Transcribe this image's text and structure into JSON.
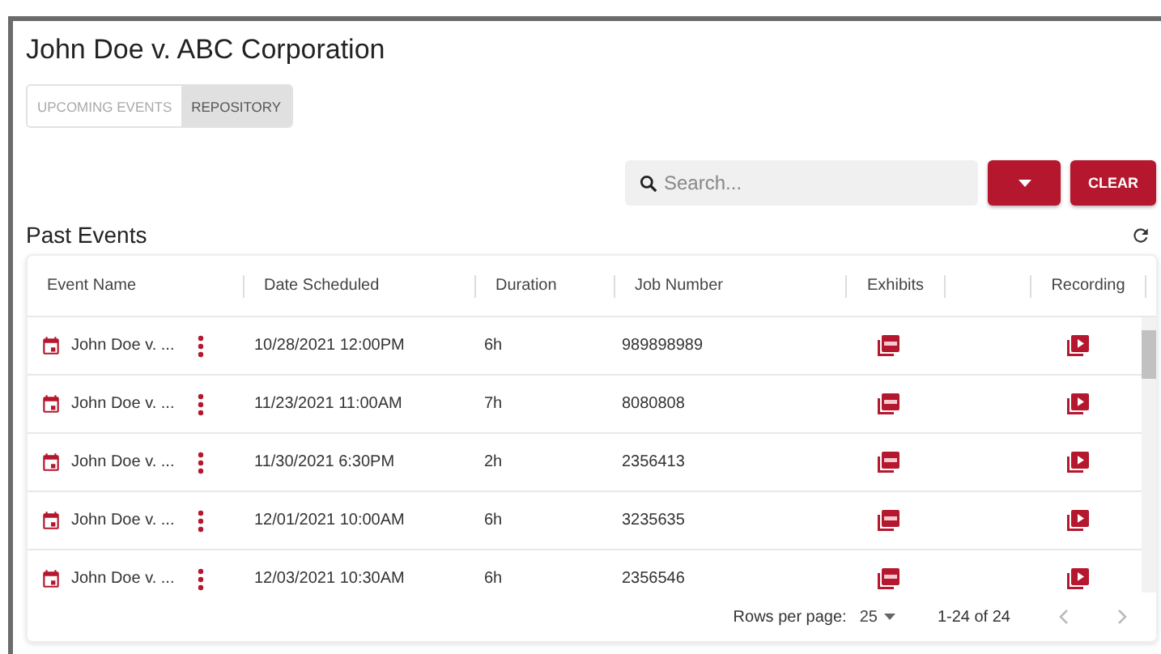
{
  "title": "John Doe v. ABC Corporation",
  "tabs": [
    {
      "label": "UPCOMING EVENTS",
      "selected": false
    },
    {
      "label": "REPOSITORY",
      "selected": true
    }
  ],
  "search": {
    "placeholder": "Search..."
  },
  "clear_button": "CLEAR",
  "section_title": "Past Events",
  "table": {
    "columns": [
      "Event Name",
      "Date Scheduled",
      "Duration",
      "Job Number",
      "Exhibits",
      "",
      "Recording"
    ],
    "rows": [
      {
        "event_name": "John Doe v. ...",
        "date": "10/28/2021 12:00PM",
        "duration": "6h",
        "job_number": "989898989"
      },
      {
        "event_name": "John Doe v. ...",
        "date": "11/23/2021 11:00AM",
        "duration": "7h",
        "job_number": "8080808"
      },
      {
        "event_name": "John Doe v. ...",
        "date": "11/30/2021 6:30PM",
        "duration": "2h",
        "job_number": "2356413"
      },
      {
        "event_name": "John Doe v. ...",
        "date": "12/01/2021 10:00AM",
        "duration": "6h",
        "job_number": "3235635"
      },
      {
        "event_name": "John Doe v. ...",
        "date": "12/03/2021 10:30AM",
        "duration": "6h",
        "job_number": "2356546"
      }
    ]
  },
  "pagination": {
    "rows_per_page_label": "Rows per page:",
    "rows_per_page": "25",
    "range": "1-24 of 24"
  }
}
